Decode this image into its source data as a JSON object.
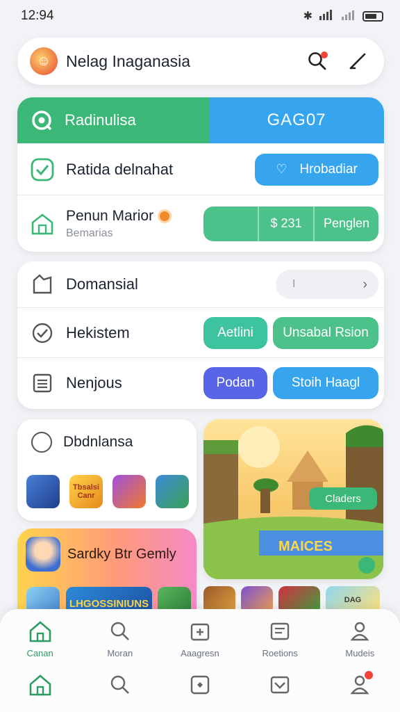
{
  "status": {
    "time": "12:94"
  },
  "header": {
    "title": "Nelag Inaganasia",
    "logo": "character-avatar"
  },
  "panel1": {
    "banner_left": "Radinulisa",
    "banner_right": "GAG07",
    "row1": {
      "title": "Ratida delnahat",
      "button": "Hrobadiar"
    },
    "row2": {
      "title": "Penun Marior",
      "subtitle": "Bemarias",
      "value": "$ 231",
      "button": "Penglen"
    }
  },
  "panel2": {
    "row1": {
      "title": "Domansial",
      "field": "I"
    },
    "row2": {
      "title": "Hekistem",
      "btn1": "Aetlini",
      "btn2": "Unsabal Rsion"
    },
    "row3": {
      "title": "Nenjous",
      "btn1": "Podan",
      "btn2": "Stoih Haagl"
    }
  },
  "games": {
    "section1": {
      "title": "Dbdnlansa",
      "tiles": [
        "",
        "Tbsalsi Canr",
        "",
        ""
      ]
    },
    "section2": {
      "title": "Sardky Btr Gemly",
      "tiles": [
        "",
        "LHGOSSINIUNS",
        ""
      ]
    },
    "featured": {
      "button": "Claders",
      "banner": "MAICES"
    },
    "right_tiles": [
      "",
      "",
      "",
      "DAG"
    ]
  },
  "nav_labels": [
    "Canan",
    "Moran",
    "Aaagresn",
    "Roetions",
    "Mudeis"
  ],
  "colors": {
    "green": "#3bb877",
    "blue": "#36a5ee",
    "purple": "#5865e6",
    "teal": "#3ec39f"
  }
}
